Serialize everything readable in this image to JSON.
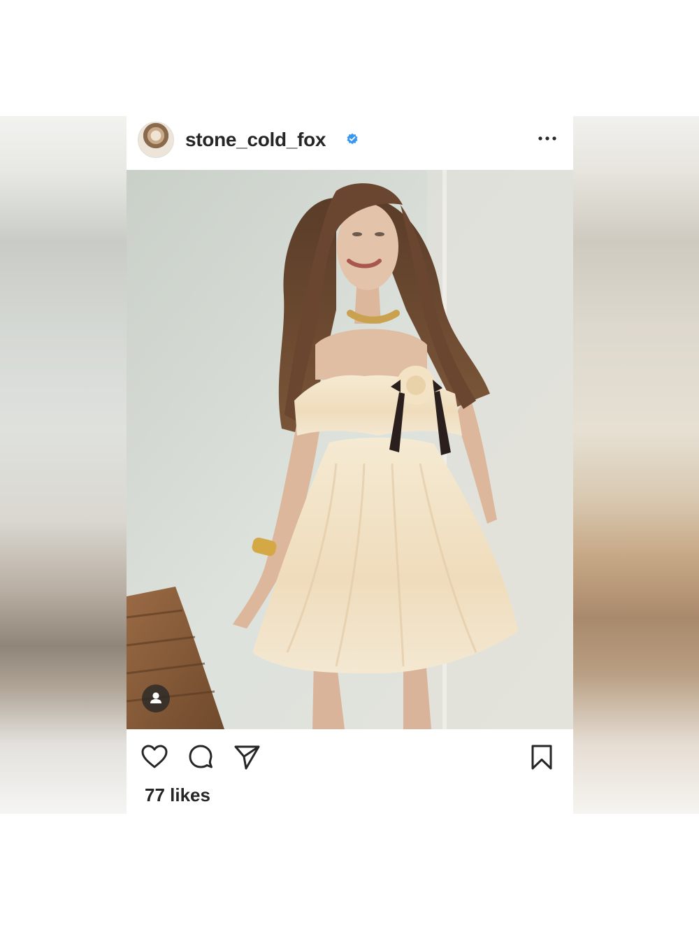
{
  "post": {
    "username": "stone_cold_fox",
    "likes_text": "77 likes"
  },
  "icons": {
    "avatar": "profile-photo",
    "verified": "verified-badge-icon",
    "more": "more-options-icon",
    "tag": "tagged-user-icon",
    "like": "heart-icon",
    "comment": "comment-bubble-icon",
    "share": "paper-plane-icon",
    "save": "bookmark-icon"
  },
  "colors": {
    "text": "#262626",
    "verified": "#3897f0",
    "background": "#ffffff"
  }
}
